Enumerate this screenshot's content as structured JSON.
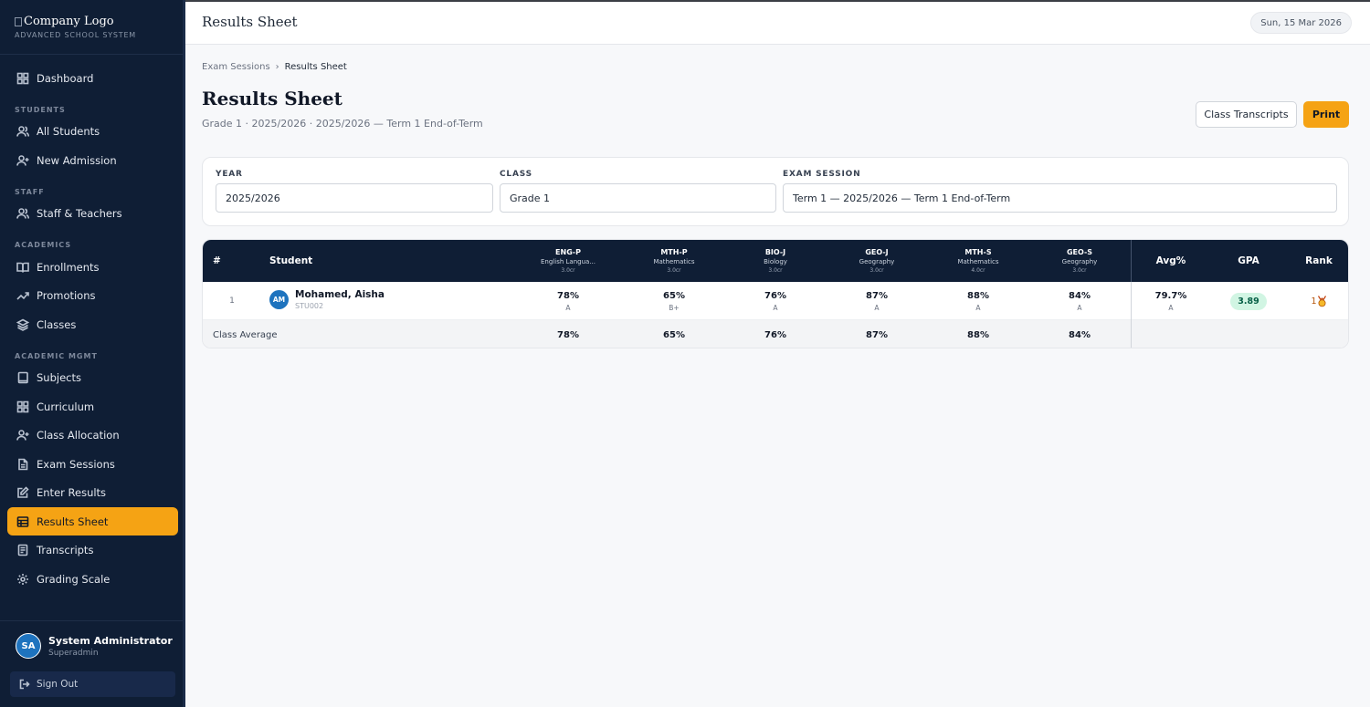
{
  "brand": {
    "logo_alt": "Company Logo",
    "subtitle": "ADVANCED SCHOOL SYSTEM"
  },
  "nav": {
    "dashboard": "Dashboard",
    "section_students": "STUDENTS",
    "all_students": "All Students",
    "new_admission": "New Admission",
    "section_staff": "STAFF",
    "staff_teachers": "Staff & Teachers",
    "section_academics": "ACADEMICS",
    "enrollments": "Enrollments",
    "promotions": "Promotions",
    "classes": "Classes",
    "section_academic_mgmt": "ACADEMIC MGMT",
    "subjects": "Subjects",
    "curriculum": "Curriculum",
    "class_allocation": "Class Allocation",
    "exam_sessions": "Exam Sessions",
    "enter_results": "Enter Results",
    "results_sheet": "Results Sheet",
    "transcripts": "Transcripts",
    "grading_scale": "Grading Scale"
  },
  "user": {
    "initials": "SA",
    "name": "System Administrator",
    "role": "Superadmin",
    "sign_out": "Sign Out"
  },
  "topbar": {
    "title": "Results Sheet",
    "date": "Sun, 15 Mar 2026"
  },
  "breadcrumb": {
    "parent": "Exam Sessions",
    "separator": "›",
    "current": "Results Sheet"
  },
  "page": {
    "title": "Results Sheet",
    "subtitle": "Grade 1 · 2025/2026 · 2025/2026 — Term 1 End-of-Term",
    "btn_transcripts": "Class Transcripts",
    "btn_print": "Print"
  },
  "filters": {
    "year_label": "YEAR",
    "year_value": "2025/2026",
    "class_label": "CLASS",
    "class_value": "Grade 1",
    "session_label": "EXAM SESSION",
    "session_value": "Term 1 — 2025/2026 — Term 1 End-of-Term"
  },
  "table": {
    "col_num": "#",
    "col_student": "Student",
    "col_avg": "Avg%",
    "col_gpa": "GPA",
    "col_rank": "Rank",
    "subjects": [
      {
        "code": "ENG-P",
        "name": "English Langua...",
        "credits": "3.0cr"
      },
      {
        "code": "MTH-P",
        "name": "Mathematics",
        "credits": "3.0cr"
      },
      {
        "code": "BIO-J",
        "name": "Biology",
        "credits": "3.0cr"
      },
      {
        "code": "GEO-J",
        "name": "Geography",
        "credits": "3.0cr"
      },
      {
        "code": "MTH-S",
        "name": "Mathematics",
        "credits": "4.0cr"
      },
      {
        "code": "GEO-S",
        "name": "Geography",
        "credits": "3.0cr"
      }
    ],
    "rows": [
      {
        "num": "1",
        "initials": "AM",
        "name": "Mohamed, Aisha",
        "id": "STU002",
        "scores": [
          {
            "pct": "78%",
            "grade": "A"
          },
          {
            "pct": "65%",
            "grade": "B+"
          },
          {
            "pct": "76%",
            "grade": "A"
          },
          {
            "pct": "87%",
            "grade": "A"
          },
          {
            "pct": "88%",
            "grade": "A"
          },
          {
            "pct": "84%",
            "grade": "A"
          }
        ],
        "avg": "79.7%",
        "avg_grade": "A",
        "gpa": "3.89",
        "rank": "1",
        "rank_icon": "medal-icon"
      }
    ],
    "class_average_label": "Class Average",
    "class_averages": [
      "78%",
      "65%",
      "76%",
      "87%",
      "88%",
      "84%"
    ]
  },
  "colors": {
    "sidebar_bg": "#0f1e35",
    "accent": "#f5a314",
    "avatar": "#1e73be",
    "gpa_pill": "#d1f5e3"
  }
}
